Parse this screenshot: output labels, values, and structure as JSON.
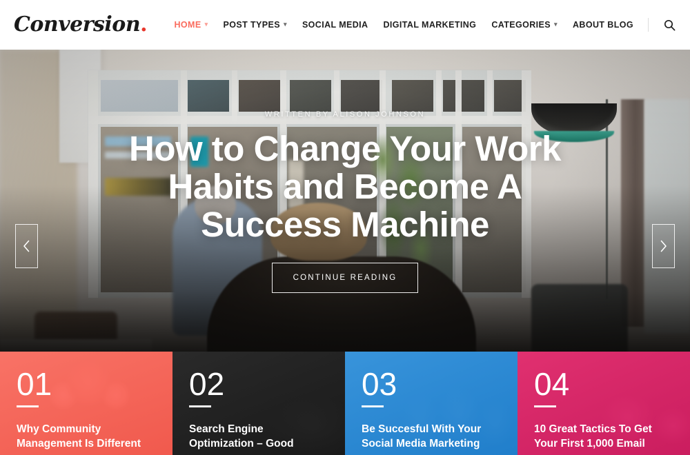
{
  "header": {
    "logo_text": "Conversion",
    "logo_dot": ".",
    "nav_items": [
      {
        "label": "HOME",
        "has_caret": true,
        "active": true
      },
      {
        "label": "POST TYPES",
        "has_caret": true,
        "active": false
      },
      {
        "label": "SOCIAL MEDIA",
        "has_caret": false,
        "active": false
      },
      {
        "label": "DIGITAL MARKETING",
        "has_caret": false,
        "active": false
      },
      {
        "label": "CATEGORIES",
        "has_caret": true,
        "active": false
      },
      {
        "label": "ABOUT BLOG",
        "has_caret": false,
        "active": false
      }
    ],
    "search_icon": "search-icon",
    "accent_color": "#fa6b5d"
  },
  "hero": {
    "byline": "WRITTEN BY ALISON JOHNSON",
    "title": "How to Change Your Work Habits and Become A Success Machine",
    "cta_label": "CONTINUE READING",
    "prev_icon": "chevron-left-icon",
    "next_icon": "chevron-right-icon"
  },
  "cards": [
    {
      "number": "01",
      "title": "Why Community Management Is Different",
      "color": "#fc6a5e"
    },
    {
      "number": "02",
      "title": "Search Engine Optimization – Good",
      "color": "#282828"
    },
    {
      "number": "03",
      "title": "Be Succesful With Your Social Media Marketing",
      "color": "#2a8cd8"
    },
    {
      "number": "04",
      "title": "10 Great Tactics To Get Your First 1,000 Email",
      "color": "#e2246a"
    }
  ]
}
